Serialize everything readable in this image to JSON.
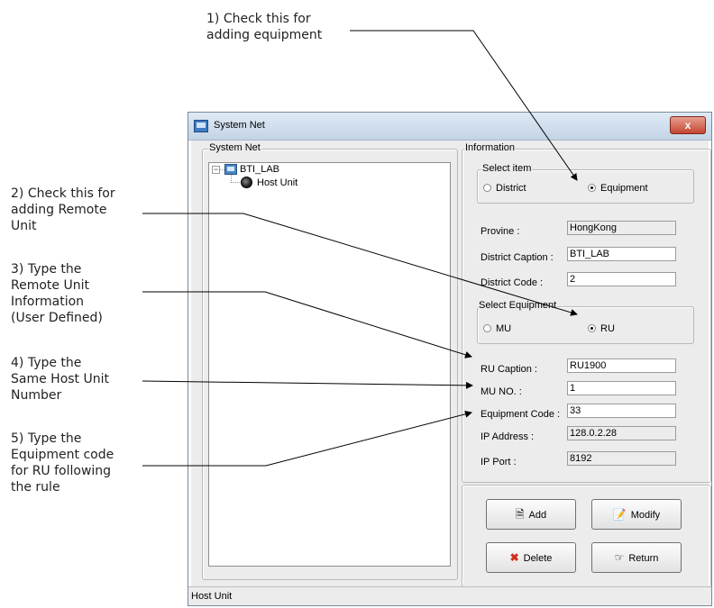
{
  "annotations": [
    {
      "lines": [
        "1) Check this for",
        "adding equipment"
      ]
    },
    {
      "lines": [
        "2) Check this for",
        "adding Remote",
        "Unit"
      ]
    },
    {
      "lines": [
        "3) Type the",
        "Remote Unit",
        "Information",
        "(User Defined)"
      ]
    },
    {
      "lines": [
        "4) Type the",
        "Same Host Unit",
        "Number"
      ]
    },
    {
      "lines": [
        "5) Type the",
        "Equipment code",
        "for RU following",
        "the rule"
      ]
    }
  ],
  "window": {
    "title": "System Net",
    "close_glyph": "x"
  },
  "tree_panel": {
    "title": "System Net",
    "root_label": "BTI_LAB",
    "child_label": "Host Unit"
  },
  "info_panel": {
    "title": "Information",
    "select_item": {
      "title": "Select item",
      "district_label": "District",
      "equipment_label": "Equipment",
      "selected": "Equipment"
    },
    "province_label": "Provine :",
    "province_value": "HongKong",
    "district_caption_label": "District Caption :",
    "district_caption_value": "BTI_LAB",
    "district_code_label": "District Code :",
    "district_code_value": "2",
    "select_equipment": {
      "title": "Select Equipment",
      "mu_label": "MU",
      "ru_label": "RU",
      "selected": "RU"
    },
    "ru_caption_label": "RU Caption :",
    "ru_caption_value": "RU1900",
    "mu_no_label": "MU NO. :",
    "mu_no_value": "1",
    "equipment_code_label": "Equipment Code :",
    "equipment_code_value": "33",
    "ip_address_label": "IP Address :",
    "ip_address_value": "128.0.2.28",
    "ip_port_label": "IP Port :",
    "ip_port_value": "8192"
  },
  "buttons": {
    "add": "Add",
    "modify": "Modify",
    "delete": "Delete",
    "return": "Return"
  },
  "status_bar": {
    "text": "Host Unit"
  },
  "colors": {
    "leader_line": "#000000",
    "delete_icon": "#d22c1c",
    "window_border": "#7a8a9a"
  },
  "icons": [
    "app-icon",
    "close-icon",
    "expand-icon",
    "computer-icon",
    "host-unit-icon",
    "add-icon",
    "modify-icon",
    "delete-icon",
    "return-icon"
  ]
}
